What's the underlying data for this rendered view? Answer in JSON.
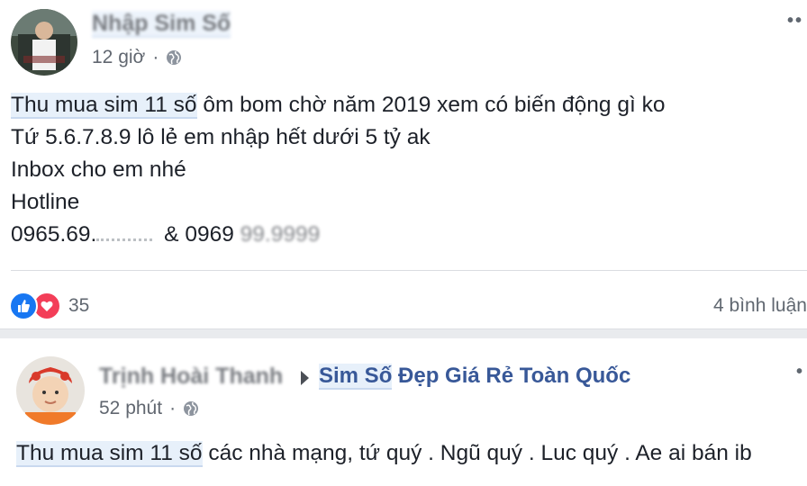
{
  "post1": {
    "author": "Nhập Sim Số",
    "time": "12 giờ",
    "lines": [
      {
        "highlight": "Thu mua sim 11 số",
        "rest": " ôm bom chờ năm 2019 xem có biến động gì ko"
      },
      {
        "text": "Tứ 5.6.7.8.9 lô lẻ em nhập hết dưới 5 tỷ ak"
      },
      {
        "text": "Inbox cho em nhé"
      },
      {
        "text": "Hotline"
      }
    ],
    "phone_a": "0965.69.",
    "phone_sep": " & 0969",
    "phone_b_faded": " 99.9999",
    "reaction_count": "35",
    "comments": "4 bình luận"
  },
  "post2": {
    "author": "Trịnh Hoài Thanh",
    "group_highlight": "Sim Số",
    "group_rest": " Đẹp Giá Rẻ Toàn Quốc",
    "time": "52 phút",
    "line_highlight": "Thu mua sim 11 số",
    "line_rest": " các nhà mạng, tứ quý . Ngũ quý . Luc quý . Ae ai bán ib"
  },
  "icons": {
    "like": "like-icon",
    "love": "heart-icon",
    "privacy": "globe-icon",
    "more": "more-options-icon"
  },
  "colors": {
    "link": "#385898",
    "like": "#1877f2",
    "love": "#f33e58",
    "meta": "#616770"
  }
}
